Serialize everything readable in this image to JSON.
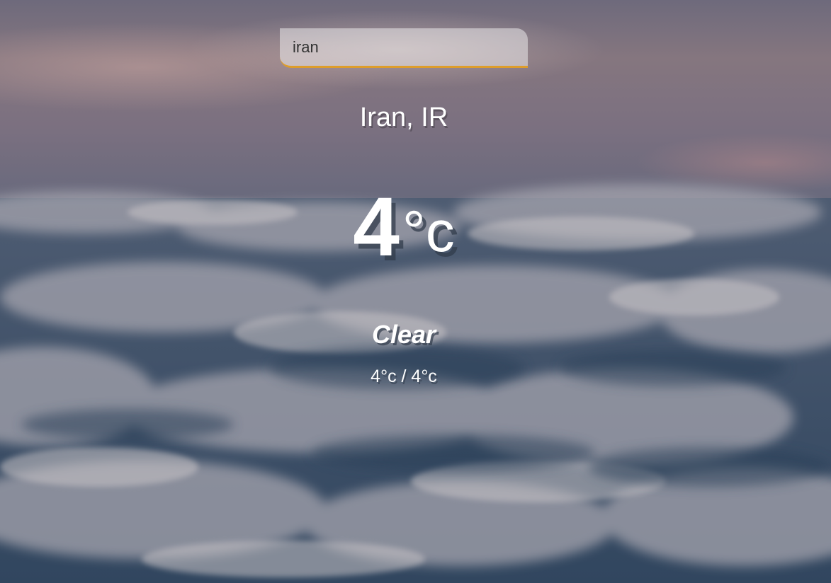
{
  "search": {
    "value": "iran",
    "accent_color": "#dd9d2b"
  },
  "location": {
    "name": "Iran, IR"
  },
  "current": {
    "temperature": "4",
    "unit": "°c"
  },
  "weather": {
    "description": "Clear",
    "hi_low": "4°c / 4°c"
  },
  "background": {
    "image": "cloudy-sky"
  }
}
